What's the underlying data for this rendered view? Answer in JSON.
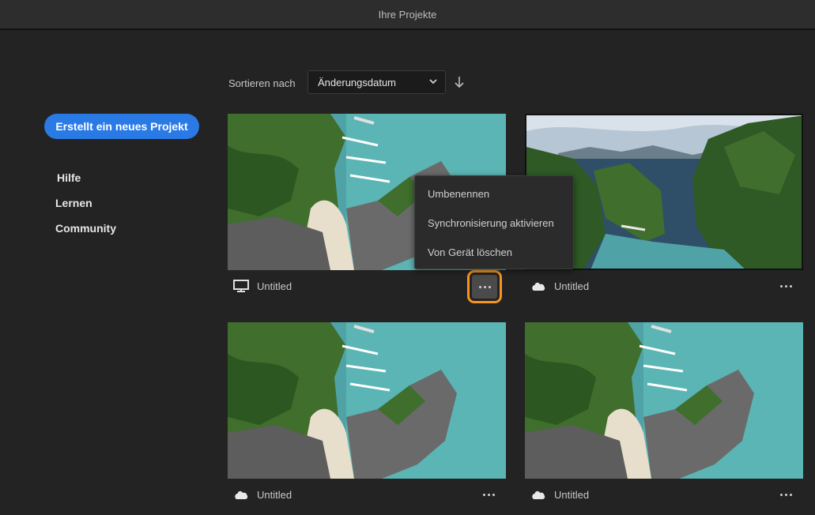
{
  "window": {
    "title": "Ihre Projekte"
  },
  "sidebar": {
    "new_project_label": "Erstellt ein neues Projekt",
    "links": [
      "Hilfe",
      "Lernen",
      "Community"
    ]
  },
  "sort": {
    "label": "Sortieren nach",
    "selected": "Änderungsdatum"
  },
  "projects": [
    {
      "name": "Untitled",
      "storage": "device",
      "thumbnail": "aerial-beach"
    },
    {
      "name": "Untitled",
      "storage": "cloud",
      "thumbnail": "lagoon-cliffs"
    },
    {
      "name": "Untitled",
      "storage": "cloud",
      "thumbnail": "aerial-beach"
    },
    {
      "name": "Untitled",
      "storage": "cloud",
      "thumbnail": "aerial-beach"
    }
  ],
  "context_menu": {
    "items": [
      "Umbenennen",
      "Synchronisierung aktivieren",
      "Von Gerät löschen"
    ]
  },
  "colors": {
    "accent": "#2a7ae6",
    "highlight": "#f7941d",
    "background": "#232323"
  },
  "icons": [
    "monitor-icon",
    "cloud-icon",
    "more-icon",
    "chevron-down-icon",
    "arrow-down-icon"
  ]
}
